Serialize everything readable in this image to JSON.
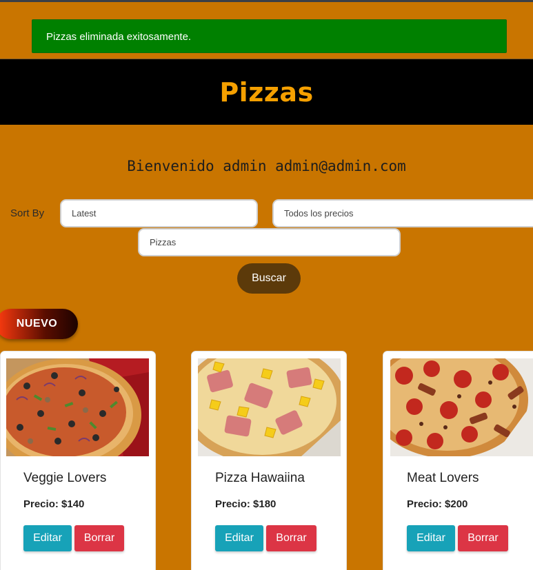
{
  "alert": {
    "message": "Pizzas eliminada exitosamente."
  },
  "header": {
    "title": "Pizzas"
  },
  "welcome": {
    "text": "Bienvenido admin admin@admin.com"
  },
  "filters": {
    "sort_label": "Sort By",
    "sort_value": "Latest",
    "price_value": "Todos los precios",
    "category_value": "Pizzas",
    "search_button": "Buscar"
  },
  "actions": {
    "new_button": "NUEVO"
  },
  "products": [
    {
      "name": "Veggie Lovers",
      "price": "Precio: $140",
      "edit_label": "Editar",
      "delete_label": "Borrar"
    },
    {
      "name": "Pizza Hawaiina",
      "price": "Precio: $180",
      "edit_label": "Editar",
      "delete_label": "Borrar"
    },
    {
      "name": "Meat Lovers",
      "price": "Precio: $200",
      "edit_label": "Editar",
      "delete_label": "Borrar"
    }
  ],
  "colors": {
    "background": "#c97500",
    "alert_success": "#008000",
    "header_bg": "#000000",
    "title_accent": "#f5a000",
    "search_button": "#5c3a0a",
    "edit_button": "#17a2b8",
    "delete_button": "#dc3545"
  }
}
